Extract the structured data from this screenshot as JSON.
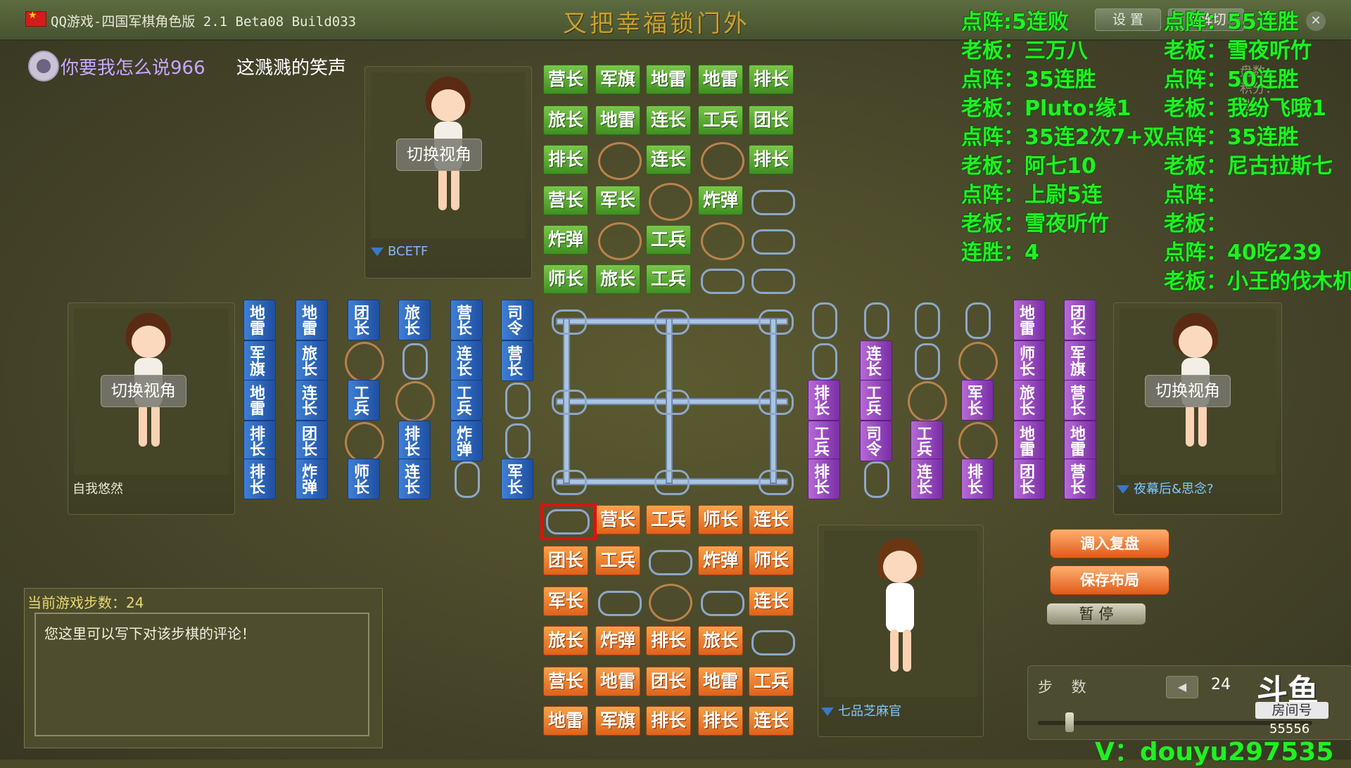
{
  "window": {
    "app_title": "QQ游戏-四国军棋角色版 2.1 Beta08 Build033",
    "game_title": "又把幸福锁门外"
  },
  "toolbar": {
    "settings": "设 置",
    "behind": "点阵切"
  },
  "marquee": {
    "part1": "你要我怎么说966",
    "part2": "这溅溅的笑声"
  },
  "players": {
    "top": {
      "name": "BCETF",
      "switch": "切换视角"
    },
    "left": {
      "name": "自我悠然",
      "switch": "切换视角"
    },
    "right": {
      "name": "夜幕后&思念?",
      "switch": "切换视角"
    },
    "bottom": {
      "name": "七品芝麻官"
    }
  },
  "board": {
    "top": [
      [
        "营长",
        "军旗",
        "地雷",
        "地雷",
        "排长"
      ],
      [
        "旅长",
        "地雷",
        "连长",
        "工兵",
        "团长"
      ],
      [
        "排长",
        "",
        "连长",
        "",
        "排长"
      ],
      [
        "营长",
        "军长",
        "",
        "炸弹",
        ""
      ],
      [
        "炸弹",
        "",
        "工兵",
        "",
        ""
      ],
      [
        "师长",
        "旅长",
        "工兵",
        "",
        ""
      ]
    ],
    "bottom": [
      [
        "",
        "营长",
        "工兵",
        "师长",
        "连长"
      ],
      [
        "团长",
        "工兵",
        "",
        "炸弹",
        "师长"
      ],
      [
        "军长",
        "",
        "",
        "",
        "连长"
      ],
      [
        "旅长",
        "炸弹",
        "排长",
        "旅长",
        ""
      ],
      [
        "营长",
        "地雷",
        "团长",
        "地雷",
        "工兵"
      ],
      [
        "地雷",
        "军旗",
        "排长",
        "排长",
        "连长"
      ]
    ],
    "left": [
      [
        "地雷",
        "地雷",
        "团长",
        "旅长",
        "营长",
        "司令"
      ],
      [
        "军旗",
        "旅长",
        "",
        "",
        "连长",
        "营长"
      ],
      [
        "地雷",
        "连长",
        "工兵",
        "",
        "工兵",
        ""
      ],
      [
        "排长",
        "团长",
        "",
        "排长",
        "炸弹",
        ""
      ],
      [
        "排长",
        "炸弹",
        "师长",
        "连长",
        "",
        "军长"
      ]
    ],
    "right": [
      [
        "",
        "",
        "",
        "",
        "地雷",
        "团长"
      ],
      [
        "",
        "连长",
        "",
        "",
        "师长",
        "军旗"
      ],
      [
        "排长",
        "工兵",
        "",
        "军长",
        "旅长",
        "营长"
      ],
      [
        "工兵",
        "司令",
        "工兵",
        "",
        "地雷",
        "地雷"
      ],
      [
        "排长",
        "",
        "连长",
        "排长",
        "团长",
        "营长"
      ]
    ]
  },
  "comment": {
    "step_label": "当前游戏步数：24",
    "placeholder": "您这里可以写下对该步棋的评论！"
  },
  "buttons": {
    "load_replay": "调入复盘",
    "save_layout": "保存布局",
    "pause": "暂  停"
  },
  "steps": {
    "label": "步  数",
    "count": "24",
    "progress": 0.1
  },
  "overlay_left": [
    "点阵:5连败",
    "老板：三万八",
    "点阵：35连胜",
    "老板：Pluto:缘1",
    "点阵：35连2次7+双",
    "老板：阿七10",
    "点阵：上尉5连",
    "老板：雪夜听竹",
    "连胜：4"
  ],
  "overlay_right": [
    "点阵：55连胜",
    "老板：雪夜听竹",
    "点阵：50连胜",
    "老板：我纷飞哦1",
    "点阵：35连胜",
    "老板：尼古拉斯七",
    "点阵：",
    "老板：",
    "点阵：40吃239",
    "老板：小王的伐木机"
  ],
  "douyu": {
    "logo": "斗鱼",
    "room_label": "房间号",
    "room_number": "55556",
    "wechat": "V：douyu297535"
  },
  "faded_labels": {
    "label1": "盘数：",
    "label2": "积分：",
    "label3": "胜"
  },
  "colors": {
    "green_piece": "#5aa832",
    "orange_piece": "#ee7a2a",
    "blue_piece": "#2a62bc",
    "purple_piece": "#9a48c0",
    "overlay_text": "#22f022"
  }
}
